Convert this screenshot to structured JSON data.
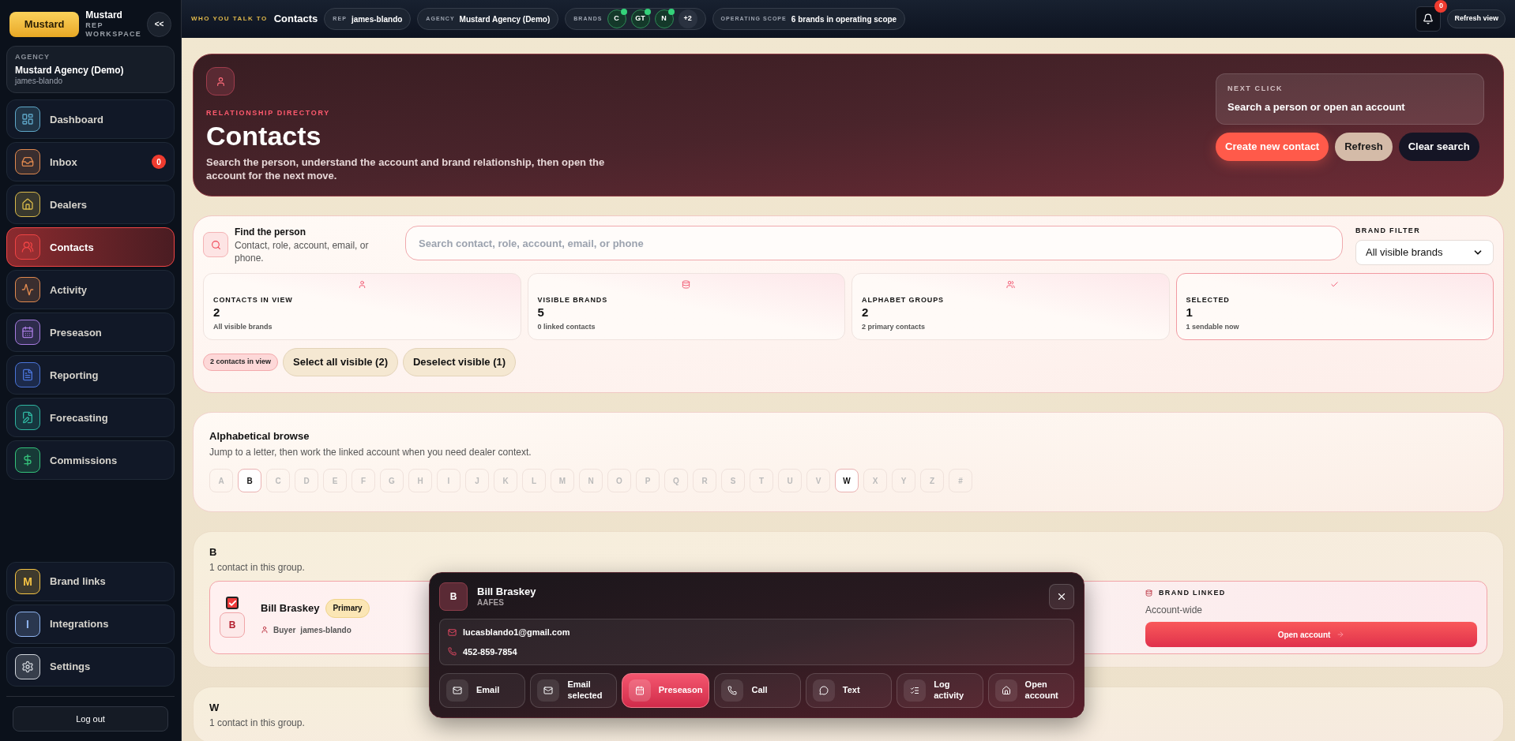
{
  "sidebar": {
    "logo": "Mustard",
    "title": "Mustard",
    "subtitle": "REP WORKSPACE",
    "collapse": "<<",
    "agency": {
      "label": "AGENCY",
      "name": "Mustard Agency (Demo)",
      "user": "james-blando"
    },
    "nav": [
      {
        "label": "Dashboard",
        "color": "#5fa8c9",
        "selected": false
      },
      {
        "label": "Inbox",
        "color": "#e0894f",
        "selected": false,
        "badge": "0"
      },
      {
        "label": "Dealers",
        "color": "#d8b94a",
        "selected": false
      },
      {
        "label": "Contacts",
        "color": "#ef4444",
        "selected": true
      },
      {
        "label": "Activity",
        "color": "#e0894f",
        "selected": false
      },
      {
        "label": "Preseason",
        "color": "#a77be0",
        "selected": false
      },
      {
        "label": "Reporting",
        "color": "#4a74d8",
        "selected": false
      },
      {
        "label": "Forecasting",
        "color": "#2fb5a0",
        "selected": false
      },
      {
        "label": "Commissions",
        "color": "#34c27a",
        "selected": false
      }
    ],
    "bottom_nav": [
      {
        "label": "Brand links",
        "kind": "letter",
        "glyph": "M",
        "color": "#f5c344",
        "selected": false
      },
      {
        "label": "Integrations",
        "kind": "letter",
        "glyph": "I",
        "color": "#8fb4f0",
        "selected": false
      },
      {
        "label": "Settings",
        "kind": "gear",
        "color": "#d1d5db",
        "selected": false
      }
    ],
    "logout": "Log out"
  },
  "topbar": {
    "eyebrow": "WHO YOU TALK TO",
    "title": "Contacts",
    "chips": [
      {
        "kind": "text",
        "label": "REP",
        "value": "james-blando"
      },
      {
        "kind": "text",
        "label": "AGENCY",
        "value": "Mustard Agency (Demo)"
      },
      {
        "kind": "brands",
        "label": "BRANDS",
        "brands": [
          {
            "text": "C",
            "checked": true
          },
          {
            "text": "GT",
            "checked": true
          },
          {
            "text": "N",
            "checked": true
          }
        ],
        "more": "+2"
      },
      {
        "kind": "text",
        "label": "OPERATING SCOPE",
        "value": "6 brands in operating scope"
      }
    ],
    "notifications": "0",
    "refresh": "Refresh view"
  },
  "header": {
    "eyebrow": "RELATIONSHIP DIRECTORY",
    "title": "Contacts",
    "description": "Search the person, understand the account and brand relationship, then open the account for the next move.",
    "next_click": {
      "label": "NEXT CLICK",
      "text": "Search a person or open an account"
    },
    "buttons": [
      {
        "label": "Create new contact",
        "kind": "primary"
      },
      {
        "label": "Refresh",
        "kind": "secondary"
      },
      {
        "label": "Clear search",
        "kind": "dark"
      }
    ]
  },
  "find": {
    "title": "Find the person",
    "description": "Contact, role, account, email, or phone.",
    "placeholder": "Search contact, role, account, email, or phone",
    "brand_filter": {
      "label": "BRAND FILTER",
      "value": "All visible brands"
    },
    "stats": [
      {
        "label": "CONTACTS IN VIEW",
        "value": "2",
        "note": "All visible brands",
        "selected": false
      },
      {
        "label": "VISIBLE BRANDS",
        "value": "5",
        "note": "0 linked contacts",
        "selected": false
      },
      {
        "label": "ALPHABET GROUPS",
        "value": "2",
        "note": "2 primary contacts",
        "selected": false
      },
      {
        "label": "SELECTED",
        "value": "1",
        "note": "1 sendable now",
        "selected": true
      }
    ],
    "count": "2 contacts in view",
    "buttons": [
      "Select all visible (2)",
      "Deselect visible (1)"
    ]
  },
  "alphabet": {
    "title": "Alphabetical browse",
    "description": "Jump to a letter, then work the linked account when you need dealer context.",
    "letters": [
      {
        "letter": "A",
        "available": false
      },
      {
        "letter": "B",
        "available": true
      },
      {
        "letter": "C",
        "available": false
      },
      {
        "letter": "D",
        "available": false
      },
      {
        "letter": "E",
        "available": false
      },
      {
        "letter": "F",
        "available": false
      },
      {
        "letter": "G",
        "available": false
      },
      {
        "letter": "H",
        "available": false
      },
      {
        "letter": "I",
        "available": false
      },
      {
        "letter": "J",
        "available": false
      },
      {
        "letter": "K",
        "available": false
      },
      {
        "letter": "L",
        "available": false
      },
      {
        "letter": "M",
        "available": false
      },
      {
        "letter": "N",
        "available": false
      },
      {
        "letter": "O",
        "available": false
      },
      {
        "letter": "P",
        "available": false
      },
      {
        "letter": "Q",
        "available": false
      },
      {
        "letter": "R",
        "available": false
      },
      {
        "letter": "S",
        "available": false
      },
      {
        "letter": "T",
        "available": false
      },
      {
        "letter": "U",
        "available": false
      },
      {
        "letter": "V",
        "available": false
      },
      {
        "letter": "W",
        "available": true
      },
      {
        "letter": "X",
        "available": false
      },
      {
        "letter": "Y",
        "available": false
      },
      {
        "letter": "Z",
        "available": false
      },
      {
        "letter": "#",
        "available": false
      }
    ]
  },
  "groups": [
    {
      "letter": "B",
      "note": "1 contact in this group.",
      "contacts": [
        {
          "name": "Bill Braskey",
          "badge": "Primary",
          "checked": true,
          "initial": "B",
          "role": "Buyer",
          "owner": "james-blando",
          "brand_label": "BRAND LINKED",
          "brand_value": "Account-wide",
          "action": "Open account"
        }
      ]
    },
    {
      "letter": "W",
      "note": "1 contact in this group."
    }
  ],
  "popup": {
    "initial": "B",
    "name": "Bill Braskey",
    "account": "AAFES",
    "email": "lucasblando1@gmail.com",
    "phone": "452-859-7854",
    "actions": [
      {
        "label": "Email",
        "selected": false
      },
      {
        "label": "Email selected",
        "selected": false
      },
      {
        "label": "Preseason",
        "selected": true
      },
      {
        "label": "Call",
        "selected": false
      },
      {
        "label": "Text",
        "selected": false
      },
      {
        "label": "Log activity",
        "selected": false
      },
      {
        "label": "Open account",
        "selected": false
      }
    ]
  }
}
